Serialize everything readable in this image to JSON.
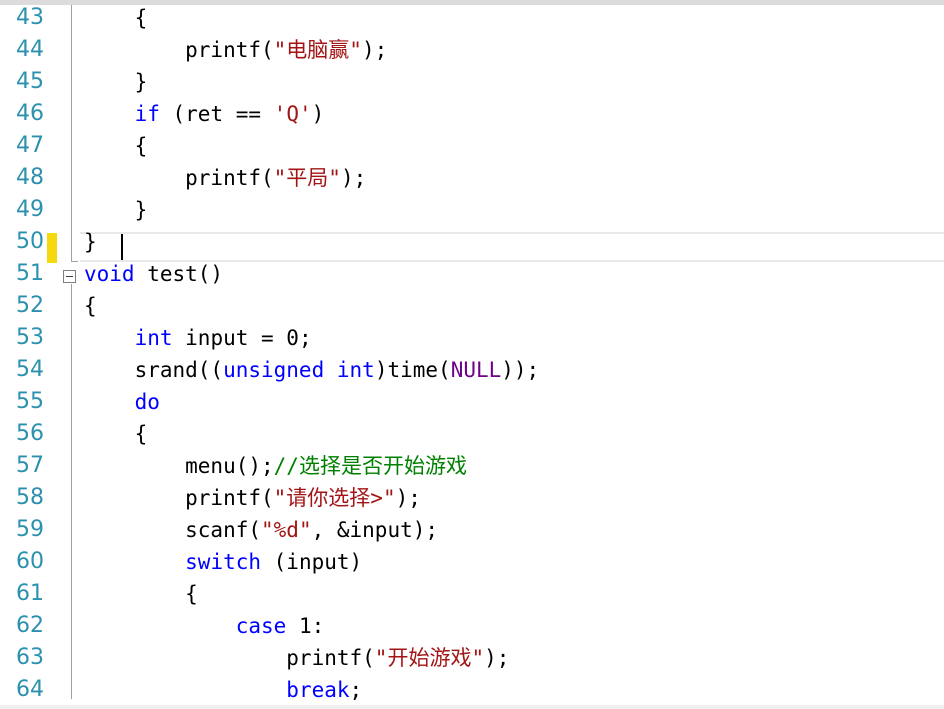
{
  "editor": {
    "lines": [
      {
        "num": "43",
        "tokens": [
          {
            "t": "    {",
            "c": ""
          }
        ]
      },
      {
        "num": "44",
        "tokens": [
          {
            "t": "        printf(",
            "c": ""
          },
          {
            "t": "\"电脑赢\"",
            "c": "str"
          },
          {
            "t": ");",
            "c": ""
          }
        ]
      },
      {
        "num": "45",
        "tokens": [
          {
            "t": "    }",
            "c": ""
          }
        ]
      },
      {
        "num": "46",
        "tokens": [
          {
            "t": "    ",
            "c": ""
          },
          {
            "t": "if",
            "c": "kw"
          },
          {
            "t": " (ret == ",
            "c": ""
          },
          {
            "t": "'Q'",
            "c": "str"
          },
          {
            "t": ")",
            "c": ""
          }
        ]
      },
      {
        "num": "47",
        "tokens": [
          {
            "t": "    {",
            "c": ""
          }
        ]
      },
      {
        "num": "48",
        "tokens": [
          {
            "t": "        printf(",
            "c": ""
          },
          {
            "t": "\"平局\"",
            "c": "str"
          },
          {
            "t": ");",
            "c": ""
          }
        ]
      },
      {
        "num": "49",
        "tokens": [
          {
            "t": "    }",
            "c": ""
          }
        ]
      },
      {
        "num": "50",
        "tokens": [
          {
            "t": "}",
            "c": ""
          }
        ]
      },
      {
        "num": "51",
        "tokens": [
          {
            "t": "void",
            "c": "kw"
          },
          {
            "t": " test()",
            "c": ""
          }
        ]
      },
      {
        "num": "52",
        "tokens": [
          {
            "t": "{",
            "c": ""
          }
        ]
      },
      {
        "num": "53",
        "tokens": [
          {
            "t": "    ",
            "c": ""
          },
          {
            "t": "int",
            "c": "kw"
          },
          {
            "t": " input = 0;",
            "c": ""
          }
        ]
      },
      {
        "num": "54",
        "tokens": [
          {
            "t": "    srand((",
            "c": ""
          },
          {
            "t": "unsigned",
            "c": "kw"
          },
          {
            "t": " ",
            "c": ""
          },
          {
            "t": "int",
            "c": "kw"
          },
          {
            "t": ")time(",
            "c": ""
          },
          {
            "t": "NULL",
            "c": "mac"
          },
          {
            "t": "));",
            "c": ""
          }
        ]
      },
      {
        "num": "55",
        "tokens": [
          {
            "t": "    ",
            "c": ""
          },
          {
            "t": "do",
            "c": "kw"
          }
        ]
      },
      {
        "num": "56",
        "tokens": [
          {
            "t": "    {",
            "c": ""
          }
        ]
      },
      {
        "num": "57",
        "tokens": [
          {
            "t": "        menu();",
            "c": ""
          },
          {
            "t": "//选择是否开始游戏",
            "c": "cm"
          }
        ]
      },
      {
        "num": "58",
        "tokens": [
          {
            "t": "        printf(",
            "c": ""
          },
          {
            "t": "\"请你选择>\"",
            "c": "str"
          },
          {
            "t": ");",
            "c": ""
          }
        ]
      },
      {
        "num": "59",
        "tokens": [
          {
            "t": "        scanf(",
            "c": ""
          },
          {
            "t": "\"%d\"",
            "c": "str"
          },
          {
            "t": ", &input);",
            "c": ""
          }
        ]
      },
      {
        "num": "60",
        "tokens": [
          {
            "t": "        ",
            "c": ""
          },
          {
            "t": "switch",
            "c": "kw"
          },
          {
            "t": " (input)",
            "c": ""
          }
        ]
      },
      {
        "num": "61",
        "tokens": [
          {
            "t": "        {",
            "c": ""
          }
        ]
      },
      {
        "num": "62",
        "tokens": [
          {
            "t": "            ",
            "c": ""
          },
          {
            "t": "case",
            "c": "kw"
          },
          {
            "t": " 1:",
            "c": ""
          }
        ]
      },
      {
        "num": "63",
        "tokens": [
          {
            "t": "                printf(",
            "c": ""
          },
          {
            "t": "\"开始游戏\"",
            "c": "str"
          },
          {
            "t": ");",
            "c": ""
          }
        ]
      },
      {
        "num": "64",
        "tokens": [
          {
            "t": "                ",
            "c": ""
          },
          {
            "t": "break",
            "c": "kw"
          },
          {
            "t": ";",
            "c": ""
          }
        ]
      }
    ],
    "current_line": "50",
    "changed_line": "50",
    "colors": {
      "line_number": "#2b91af",
      "keyword": "#0000ff",
      "string": "#a31515",
      "comment": "#008000",
      "macro": "#6f008a",
      "change_marker": "#f5d90c"
    }
  }
}
